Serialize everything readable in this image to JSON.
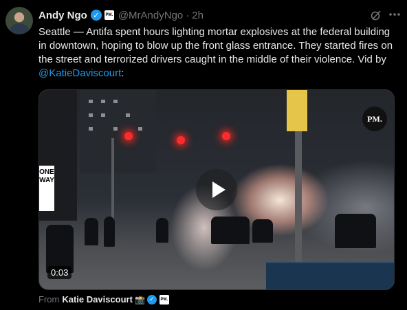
{
  "author": {
    "name": "Andy Ngo",
    "handle": "@MrAndyNgo",
    "time": "2h",
    "verified": true,
    "affiliate_badge": "PM."
  },
  "tweet": {
    "text_prefix": "Seattle — Antifa spent hours lighting mortar explosives at the federal building in downtown, hoping to blow up the front glass entrance. They started fires on the street and terrorized drivers caught in the middle of their violence. Vid by ",
    "mention": "@KatieDaviscourt",
    "text_suffix": ":"
  },
  "video": {
    "duration": "0:03",
    "watermark": "PM.",
    "sign_text": "ONE WAY"
  },
  "source": {
    "from_label": "From",
    "name": "Katie Daviscourt",
    "emoji": "📸",
    "affiliate_badge": "PM."
  },
  "icons": {
    "verified": "verified-check-icon",
    "grok": "grok-icon",
    "more": "more-horizontal-icon",
    "play": "play-icon",
    "camera": "camera-icon"
  },
  "colors": {
    "background": "#000000",
    "text": "#e7e9ea",
    "muted": "#71767b",
    "accent": "#1d9bf0"
  }
}
